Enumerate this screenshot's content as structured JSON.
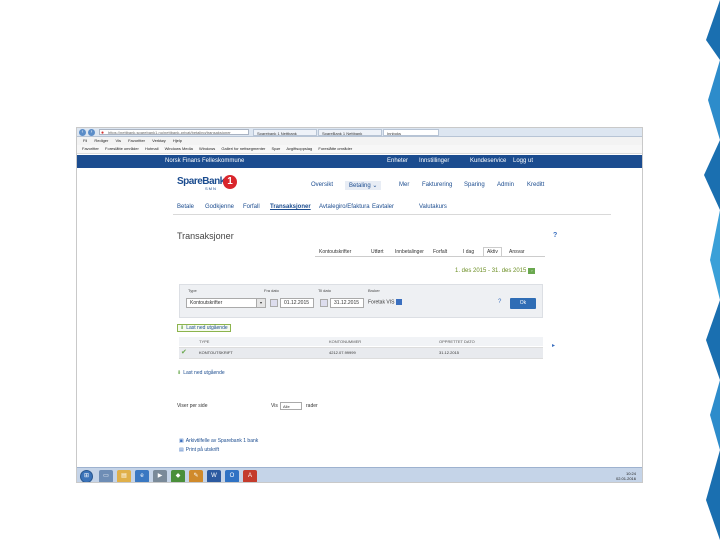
{
  "browser": {
    "address": "https://nettbank.sparebank1.no/nettbank-privat/betaling/transaksjoner",
    "tabs": [
      {
        "label": "Sparebank 1 Nettbank",
        "active": false
      },
      {
        "label": "SpareBank 1 Nettbank",
        "active": true
      },
      {
        "label": "Innboks",
        "active": false
      }
    ],
    "menu": [
      "Fil",
      "Rediger",
      "Vis",
      "Favoritter",
      "Verktøy",
      "Hjelp"
    ],
    "favorites": [
      "Favoritter",
      "Foreslåtte områder",
      "Hotmail",
      "Windows Media",
      "Windows",
      "Galleri for nettsegmenter",
      "Spør",
      "Avgiftsoppslag",
      "Foreslåtte områder"
    ]
  },
  "bank_header": {
    "org": "Norsk Finans Felleskommune",
    "links": [
      "Enheter",
      "Innstillinger",
      "Kundeservice",
      "Logg ut"
    ]
  },
  "logo": {
    "word": "SpareBank",
    "sub": "SMN",
    "mark": "1"
  },
  "main_nav": [
    "Oversikt",
    "Betaling",
    "Mer",
    "Fakturering",
    "Sparing",
    "Admin",
    "Kreditt"
  ],
  "sub_nav": [
    "Betale",
    "Godkjenne",
    "Forfall",
    "Transaksjoner",
    "Avtalegiro/Efaktura",
    "Eavtaler",
    "Valutakurs"
  ],
  "page_title": "Transaksjoner",
  "filter_tabs": [
    "Kontoutskrifter",
    "Utført",
    "Innbetalinger",
    "Forfalt",
    "I dag",
    "Aktiv",
    "Ansvar"
  ],
  "active_filter_tab": "Aktiv",
  "date_range": "1. des 2015 - 31. des 2015",
  "filter": {
    "labels": {
      "type": "Type",
      "from": "Fra dato",
      "to": "Til dato",
      "user": "Bruker"
    },
    "type_value": "Kontoutskrifter",
    "from_value": "01.12.2015",
    "to_value": "31.12.2015",
    "user_value": "Foretak VIS",
    "ok_label": "Ok"
  },
  "download_label": "Last ned utgående",
  "table": {
    "headers": [
      "TYPE",
      "KONTONUMMER",
      "OPPRETTET DATO"
    ],
    "rows": [
      {
        "type": "KONTOUTSKRIFT",
        "account": "4212.07.99999",
        "date": "31.12.2015",
        "checked": true
      }
    ]
  },
  "pagination": {
    "label": "Viser per side",
    "value": "Alle",
    "per_label": "Vis",
    "suffix": "rader"
  },
  "footer_links": [
    "Arkivtilfelle av Sparebank 1 bank",
    "Print på utskrift"
  ],
  "clock": {
    "time": "10:24",
    "date": "02.01.2016"
  },
  "colors": {
    "bank_blue": "#1b4c8f",
    "accent_red": "#d9262c",
    "ok_green": "#6aa84f"
  }
}
